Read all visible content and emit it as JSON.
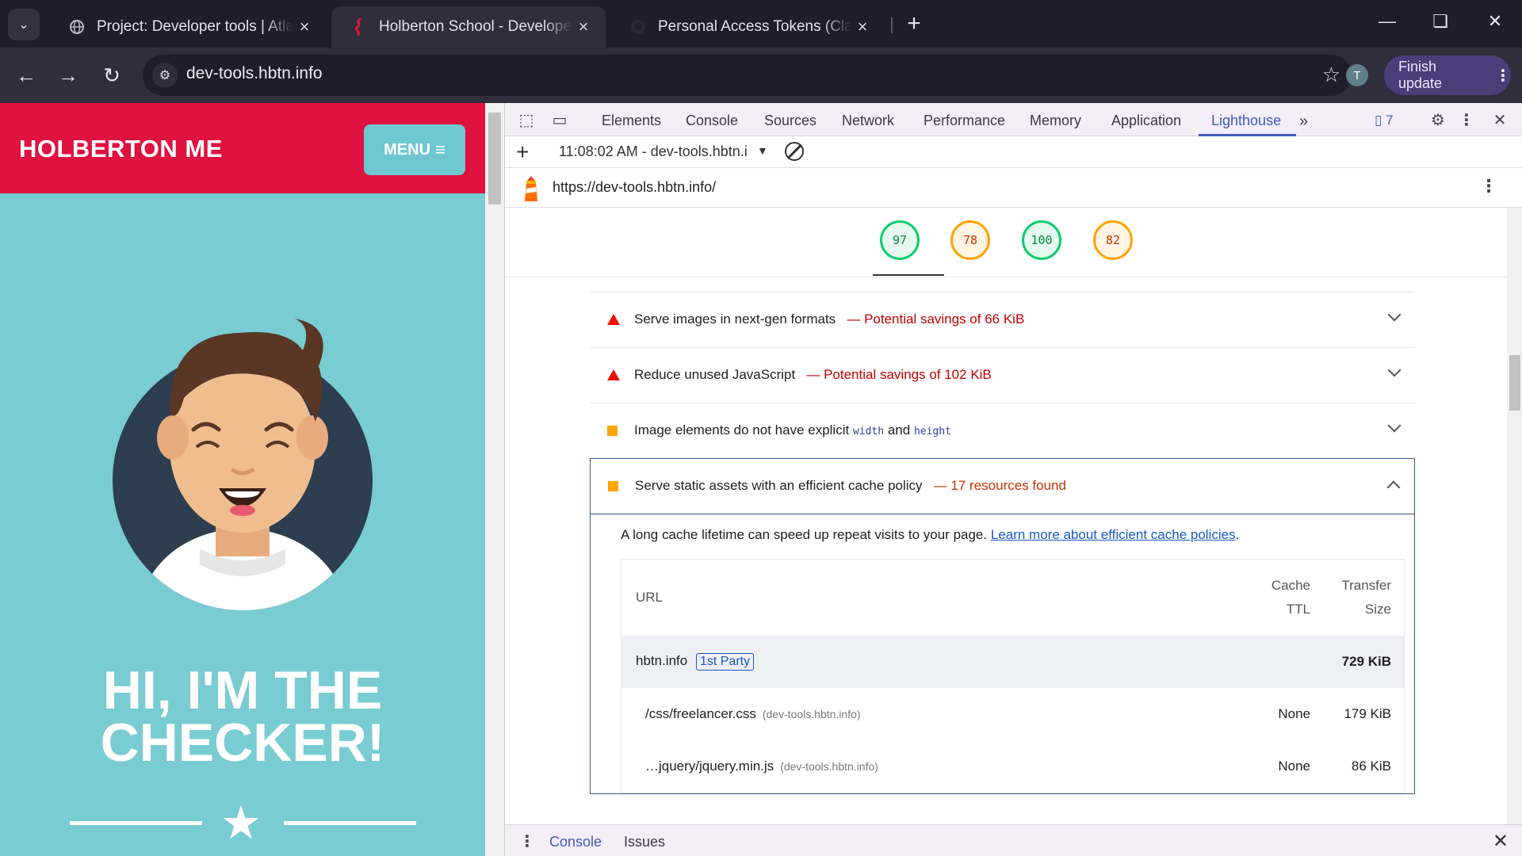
{
  "browser": {
    "tabs": [
      {
        "title": "Project: Developer tools | Atlas"
      },
      {
        "title": "Holberton School - Developer tools"
      },
      {
        "title": "Personal Access Tokens (Classic)"
      }
    ],
    "url": "dev-tools.hbtn.info",
    "profile_initial": "T",
    "finish_update": "Finish update"
  },
  "page": {
    "brand": "HOLBERTON ME",
    "menu_label": "MENU",
    "hero_line1": "HI, I'M THE",
    "hero_line2": "CHECKER!"
  },
  "devtools": {
    "tabs": [
      "Elements",
      "Console",
      "Sources",
      "Network",
      "Performance",
      "Memory",
      "Application",
      "Lighthouse"
    ],
    "active_tab": "Lighthouse",
    "issues_count": "7",
    "report_selector": "11:08:02 AM - dev-tools.hbtn.i",
    "report_url": "https://dev-tools.hbtn.info/",
    "scores": [
      {
        "value": "97",
        "status": "pass"
      },
      {
        "value": "78",
        "status": "average"
      },
      {
        "value": "100",
        "status": "pass"
      },
      {
        "value": "82",
        "status": "average"
      }
    ],
    "audits": [
      {
        "title": "Serve images in next-gen formats",
        "detail": "— Potential savings of 66 KiB",
        "severity": "fail"
      },
      {
        "title": "Reduce unused JavaScript",
        "detail": "— Potential savings of 102 KiB",
        "severity": "fail"
      },
      {
        "title_pre": "Image elements do not have explicit",
        "code1": "width",
        "title_mid": "and",
        "code2": "height",
        "severity": "average"
      },
      {
        "title": "Serve static assets with an efficient cache policy",
        "detail": "— 17 resources found",
        "severity": "average"
      }
    ],
    "open_audit": {
      "description": "A long cache lifetime can speed up repeat visits to your page.",
      "link": "Learn more about efficient cache policies",
      "period": ".",
      "table": {
        "col_url": "URL",
        "col_ttl_1": "Cache",
        "col_ttl_2": "TTL",
        "col_size_1": "Transfer",
        "col_size_2": "Size",
        "group": {
          "name": "hbtn.info",
          "badge": "1st Party",
          "size": "729 KiB"
        },
        "rows": [
          {
            "url": "/css/freelancer.css",
            "host": "(dev-tools.hbtn.info)",
            "ttl": "None",
            "size": "179 KiB"
          },
          {
            "url": "…jquery/jquery.min.js",
            "host": "(dev-tools.hbtn.info)",
            "ttl": "None",
            "size": "86 KiB"
          }
        ]
      }
    },
    "drawer_tabs": [
      "Console",
      "Issues"
    ]
  },
  "colors": {
    "brand_red": "#e0123f",
    "hero_bg": "#78ccd2",
    "pass": "#0cce6b",
    "average": "#ffa400",
    "fail": "#eb0f00"
  }
}
